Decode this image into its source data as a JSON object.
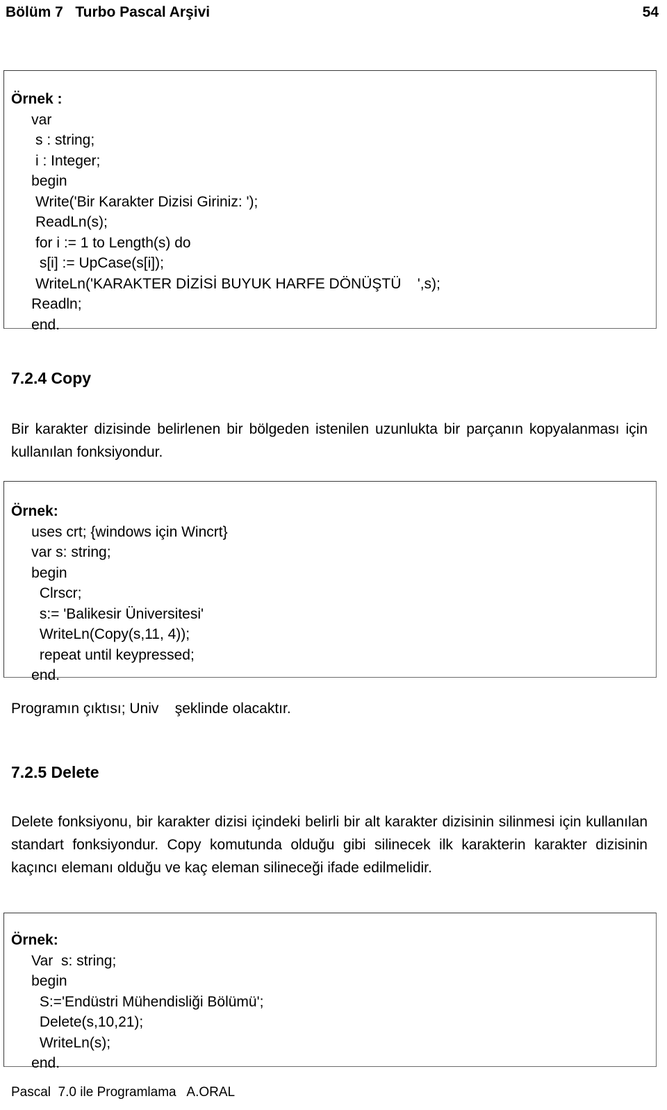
{
  "header": {
    "chapter": "Bölüm 7   Turbo Pascal Arşivi",
    "page_number": "54"
  },
  "example_box_1": {
    "title": "Örnek :",
    "lines": [
      "     var",
      "      s : string;",
      "      i : Integer;",
      "     begin",
      "      Write('Bir Karakter Dizisi Giriniz: ');",
      "      ReadLn(s);",
      "      for i := 1 to Length(s) do",
      "       s[i] := UpCase(s[i]);",
      "      WriteLn('KARAKTER DİZİSİ BUYUK HARFE DÖNÜŞTÜ    ',s);",
      "     Readln;",
      "     end."
    ]
  },
  "section_copy": {
    "heading": "7.2.4 Copy",
    "paragraph": "Bir karakter dizisinde belirlenen bir bölgeden  istenilen uzunlukta bir parçanın kopyalanması için kullanılan fonksiyondur."
  },
  "example_box_2": {
    "title": "Örnek:",
    "lines": [
      "     uses crt; {windows için Wincrt}",
      "     var s: string;",
      "     begin",
      "       Clrscr;",
      "       s:= 'Balikesir Üniversitesi'",
      "       WriteLn(Copy(s,11, 4));",
      "       repeat until keypressed;",
      "     end."
    ]
  },
  "output_note": "Programın çıktısı; Univ    şeklinde olacaktır.",
  "section_delete": {
    "heading": "7.2.5 Delete",
    "paragraph": "Delete fonksiyonu, bir karakter dizisi içindeki belirli bir alt karakter  dizisinin silinmesi için kullanılan standart fonksiyondur. Copy komutunda olduğu gibi silinecek ilk karakterin karakter dizisinin kaçıncı elemanı olduğu ve kaç eleman silineceği ifade edilmelidir."
  },
  "example_box_3": {
    "title": "Örnek:",
    "lines": [
      "     Var  s: string;",
      "     begin",
      "       S:='Endüstri Mühendisliği Bölümü';",
      "       Delete(s,10,21);",
      "       WriteLn(s);",
      "     end."
    ]
  },
  "footer": "Pascal  7.0 ile Programlama   A.ORAL"
}
